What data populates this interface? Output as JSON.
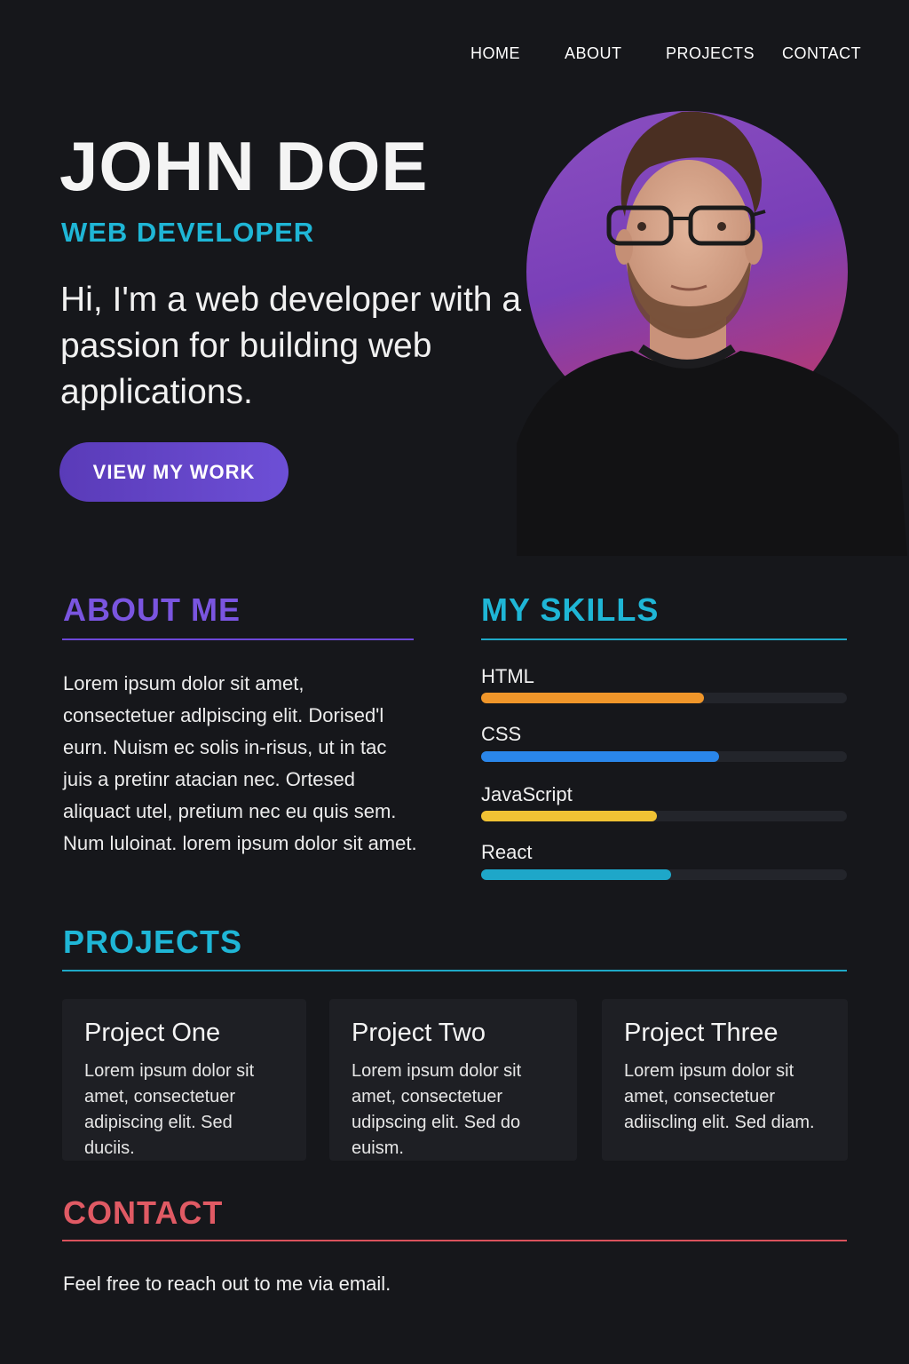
{
  "nav": {
    "items": [
      {
        "label": "HOME"
      },
      {
        "label": "ABOUT"
      },
      {
        "label": "PROJECTS"
      },
      {
        "label": "CONTACT"
      }
    ]
  },
  "hero": {
    "name": "JOHN DOE",
    "role": "WEB DEVELOPER",
    "intro": "Hi, I'm a web developer with a passion for building web applications.",
    "cta_label": "VIEW MY WORK",
    "portrait": "portrait-photo"
  },
  "about": {
    "title": "ABOUT ME",
    "text": "Lorem ipsum dolor sit amet, consectetuer adlpiscing elit. Dorised'l eurn. Nuism ec solis in-risus, ut in tac juis a pretinr atacian nec. Ortesed aliquact utel, pretium nec eu quis sem. Num luloinat. lorem ipsum dolor sit amet."
  },
  "skills": {
    "title": "MY SKILLS",
    "items": [
      {
        "label": "HTML",
        "level": 0.61,
        "color": "#f0962a"
      },
      {
        "label": "CSS",
        "level": 0.65,
        "color": "#2a86ea"
      },
      {
        "label": "JavaScript",
        "level": 0.48,
        "color": "#f0c234"
      },
      {
        "label": "React",
        "level": 0.52,
        "color": "#1ea7c9"
      }
    ]
  },
  "projects": {
    "title": "PROJECTS",
    "items": [
      {
        "title": "Project One",
        "text": "Lorem ipsum dolor sit amet, consectetuer adipiscing elit. Sed duciis."
      },
      {
        "title": "Project Two",
        "text": "Lorem ipsum dolor sit amet, consectetuer udipscing elit. Sed do euism."
      },
      {
        "title": "Project Three",
        "text": "Lorem ipsum dolor sit amet, consectetuer adiiscling elit. Sed diam."
      }
    ]
  },
  "contact": {
    "title": "CONTACT",
    "text": "Feel free to reach out to me via email."
  },
  "colors": {
    "background": "#16171b",
    "about_accent": "#7a55e0",
    "skills_accent": "#1fb6d6",
    "projects_accent": "#1fb6d6",
    "contact_accent": "#e05a64",
    "cta": "#5e40c4"
  }
}
